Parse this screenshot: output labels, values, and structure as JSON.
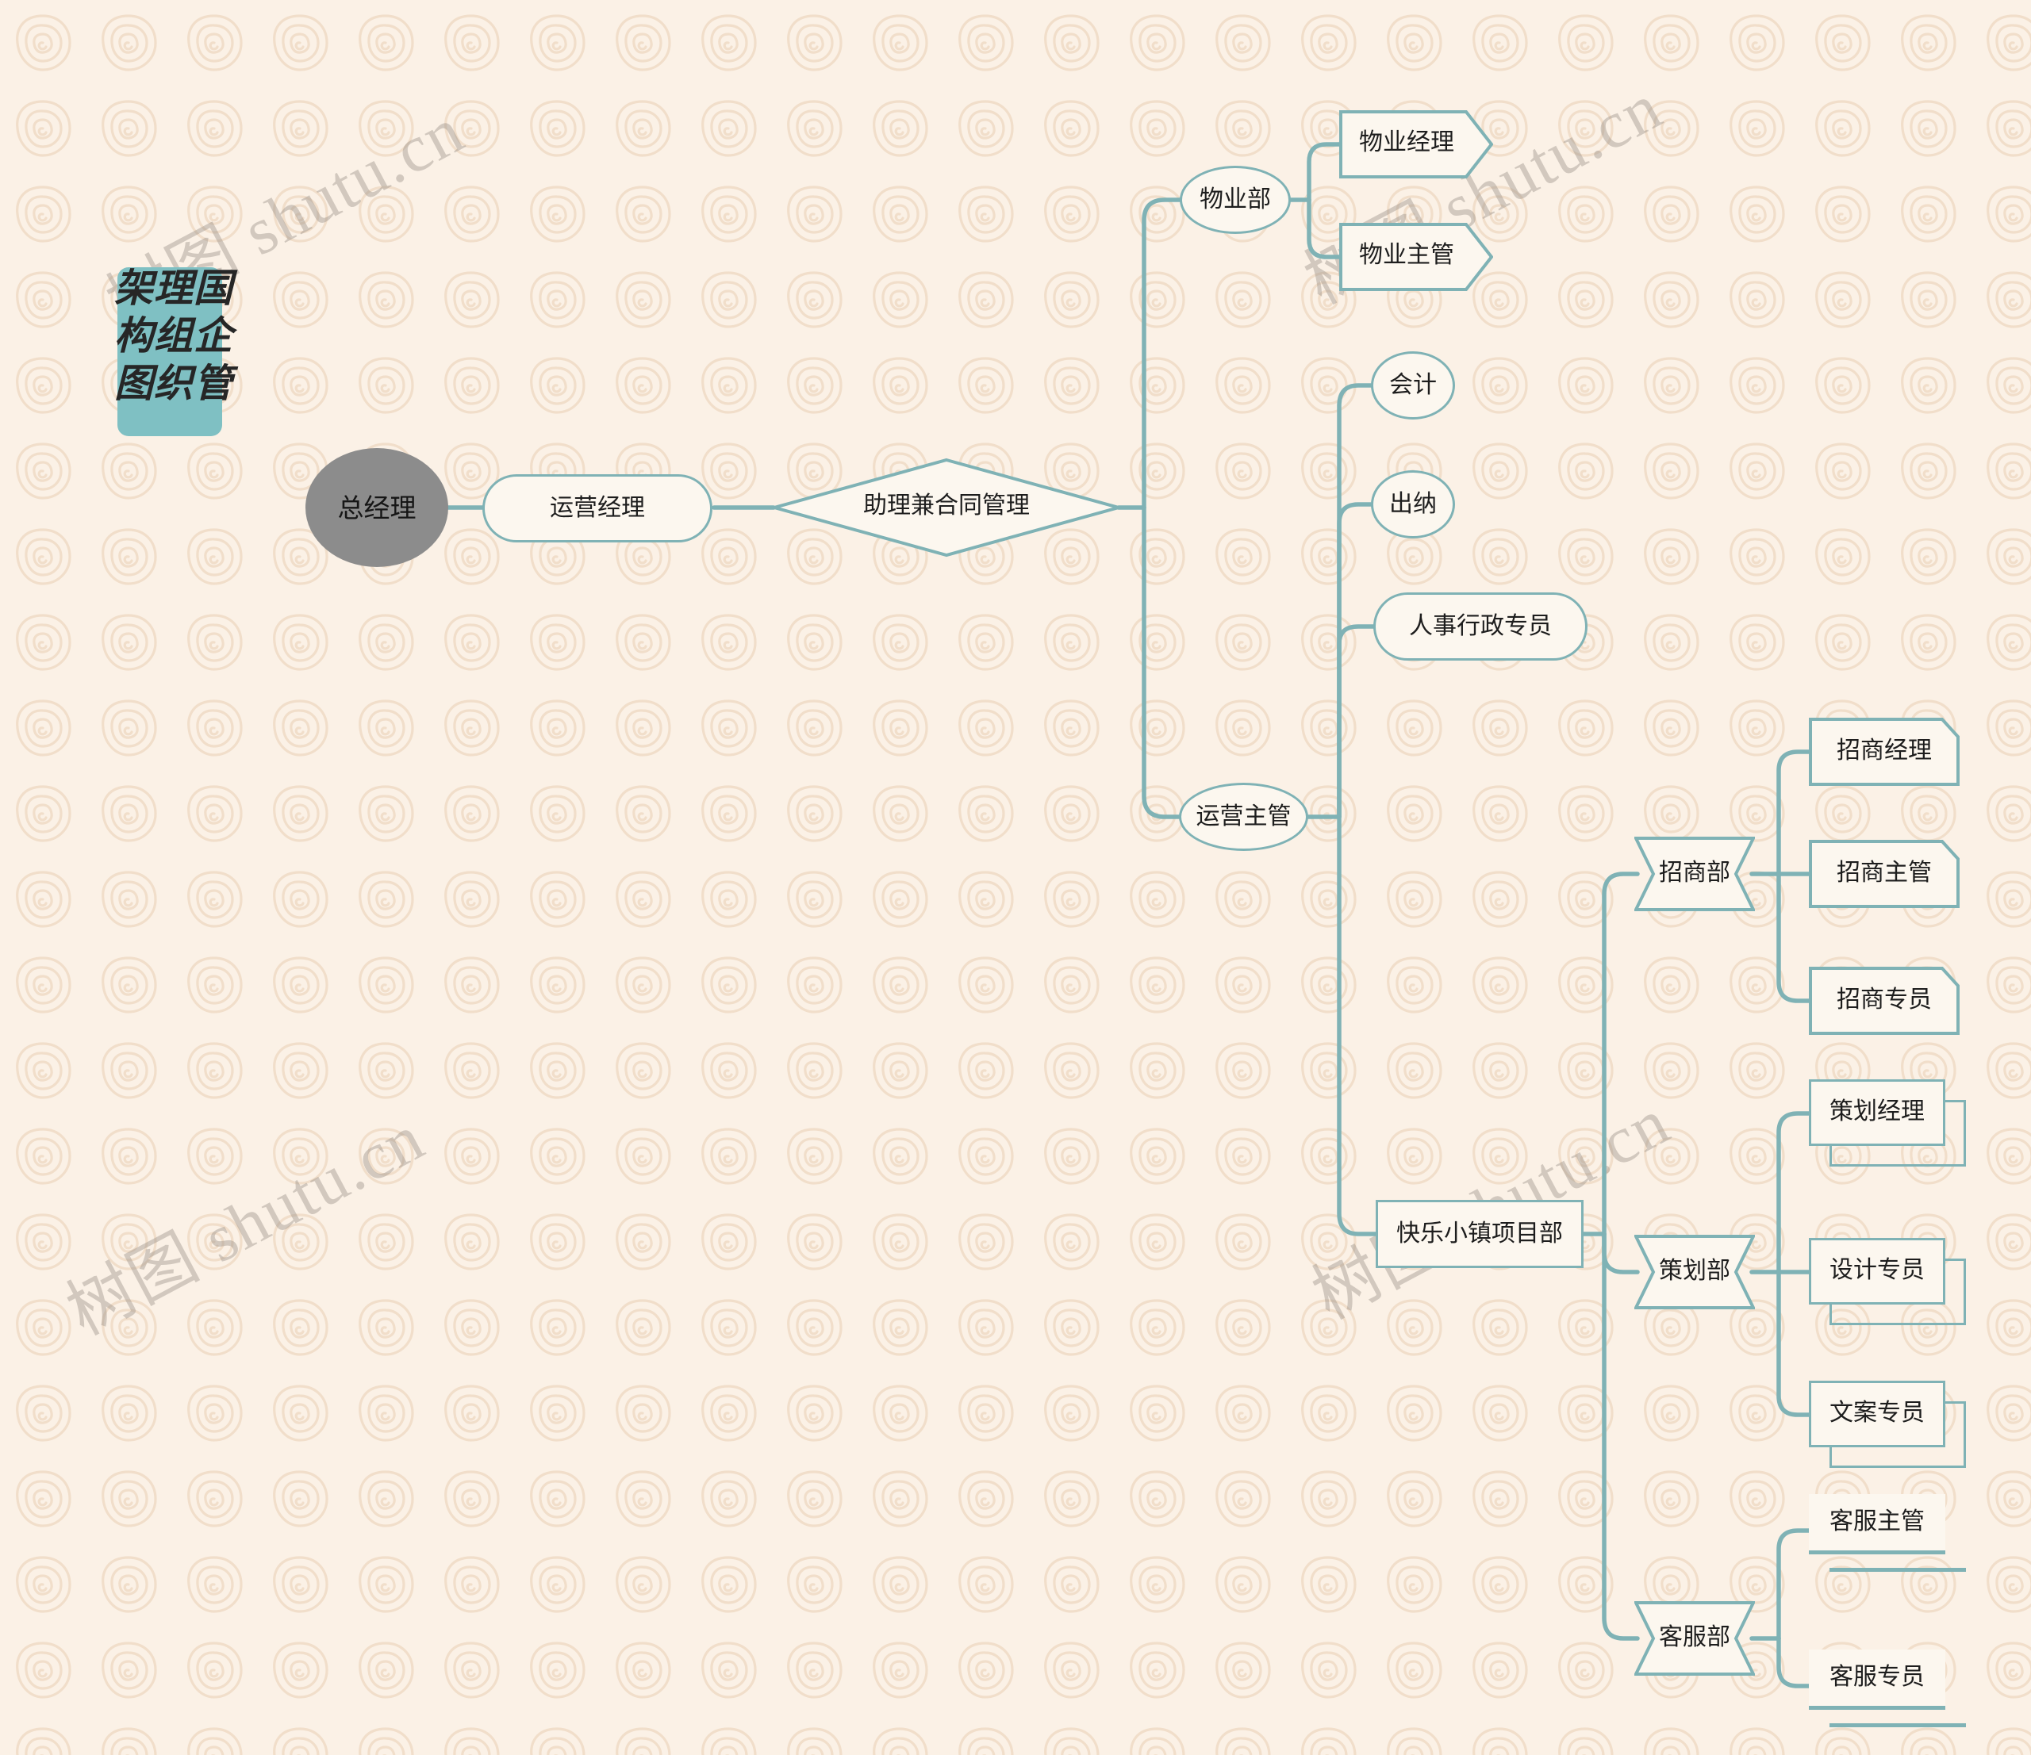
{
  "document": {
    "title": "国企管理组织架构图",
    "type": "mindmap",
    "background_color": "#FBF1E6",
    "accent_color": "#7FB2B5",
    "title_card_color": "#7FC0C3",
    "root_node_color": "#8C8C8C",
    "node_fill_color": "#FCF7EF"
  },
  "watermark": {
    "text": "树图 shutu.cn",
    "color": "#9A9289",
    "rotation_deg": -28
  },
  "nodes": {
    "root": {
      "label": "总经理",
      "shape": "circle"
    },
    "operations_manager": {
      "label": "运营经理",
      "shape": "pill"
    },
    "assistant_contract": {
      "label": "助理兼合同管理",
      "shape": "diamond"
    },
    "property_dept": {
      "label": "物业部",
      "shape": "ellipse"
    },
    "property_manager": {
      "label": "物业经理",
      "shape": "arrow"
    },
    "property_supervisor": {
      "label": "物业主管",
      "shape": "arrow"
    },
    "operations_supervisor": {
      "label": "运营主管",
      "shape": "ellipse"
    },
    "accountant": {
      "label": "会计",
      "shape": "ellipse"
    },
    "cashier": {
      "label": "出纳",
      "shape": "ellipse"
    },
    "hr_admin_specialist": {
      "label": "人事行政专员",
      "shape": "pill"
    },
    "happy_town_project_dept": {
      "label": "快乐小镇项目部",
      "shape": "rect"
    },
    "investment_dept": {
      "label": "招商部",
      "shape": "trapezoid"
    },
    "investment_manager": {
      "label": "招商经理",
      "shape": "snip-corner"
    },
    "investment_supervisor": {
      "label": "招商主管",
      "shape": "snip-corner"
    },
    "investment_specialist": {
      "label": "招商专员",
      "shape": "snip-corner"
    },
    "planning_dept": {
      "label": "策划部",
      "shape": "trapezoid"
    },
    "planning_manager": {
      "label": "策划经理",
      "shape": "shadow-box"
    },
    "design_specialist": {
      "label": "设计专员",
      "shape": "shadow-box"
    },
    "copywriting_specialist": {
      "label": "文案专员",
      "shape": "shadow-box"
    },
    "customer_service_dept": {
      "label": "客服部",
      "shape": "trapezoid"
    },
    "cs_supervisor": {
      "label": "客服主管",
      "shape": "double-underline"
    },
    "cs_specialist": {
      "label": "客服专员",
      "shape": "double-underline"
    }
  },
  "chart_data": {
    "type": "tree",
    "title": "国企管理组织架构图",
    "root": "总经理",
    "edges": [
      [
        "总经理",
        "运营经理"
      ],
      [
        "运营经理",
        "助理兼合同管理"
      ],
      [
        "助理兼合同管理",
        "物业部"
      ],
      [
        "助理兼合同管理",
        "运营主管"
      ],
      [
        "物业部",
        "物业经理"
      ],
      [
        "物业部",
        "物业主管"
      ],
      [
        "运营主管",
        "会计"
      ],
      [
        "运营主管",
        "出纳"
      ],
      [
        "运营主管",
        "人事行政专员"
      ],
      [
        "运营主管",
        "快乐小镇项目部"
      ],
      [
        "快乐小镇项目部",
        "招商部"
      ],
      [
        "快乐小镇项目部",
        "策划部"
      ],
      [
        "快乐小镇项目部",
        "客服部"
      ],
      [
        "招商部",
        "招商经理"
      ],
      [
        "招商部",
        "招商主管"
      ],
      [
        "招商部",
        "招商专员"
      ],
      [
        "策划部",
        "策划经理"
      ],
      [
        "策划部",
        "设计专员"
      ],
      [
        "策划部",
        "文案专员"
      ],
      [
        "客服部",
        "客服主管"
      ],
      [
        "客服部",
        "客服专员"
      ]
    ]
  }
}
